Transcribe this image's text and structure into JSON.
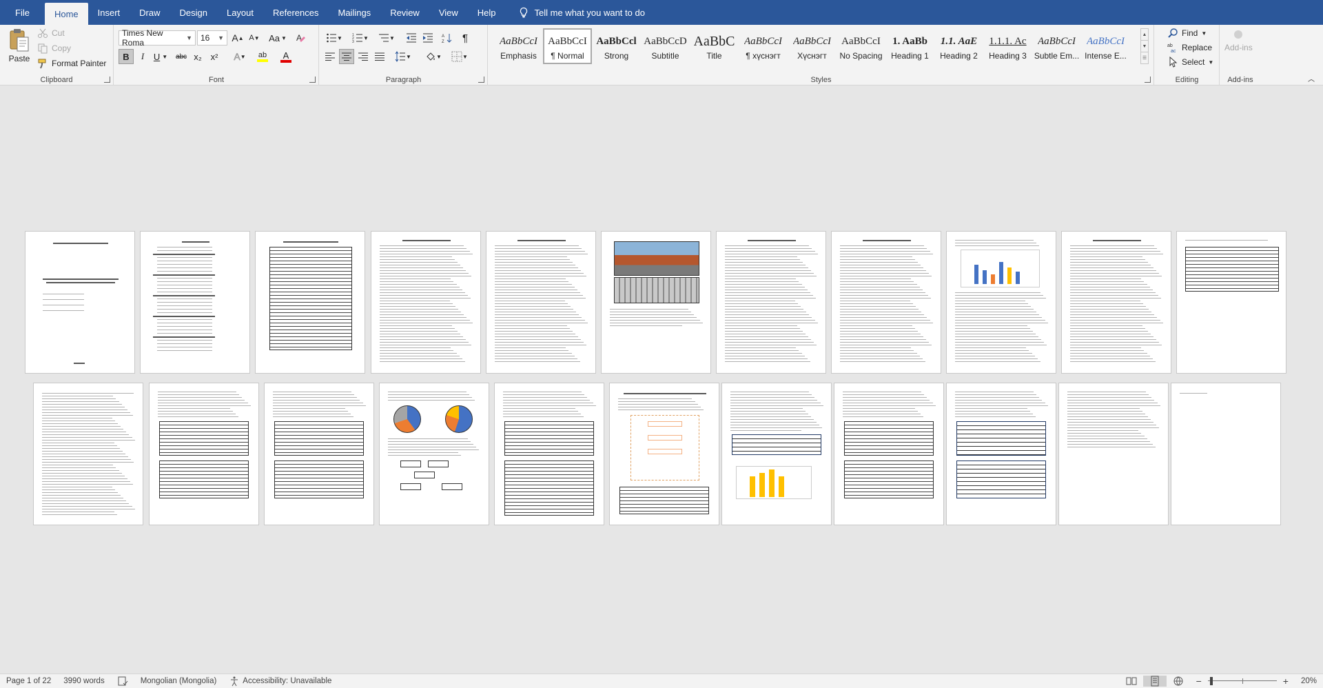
{
  "menu": {
    "tabs": [
      "File",
      "Home",
      "Insert",
      "Draw",
      "Design",
      "Layout",
      "References",
      "Mailings",
      "Review",
      "View",
      "Help"
    ],
    "active": "Home",
    "tell_me": "Tell me what you want to do"
  },
  "clipboard": {
    "paste": "Paste",
    "cut": "Cut",
    "copy": "Copy",
    "format_painter": "Format Painter",
    "label": "Clipboard"
  },
  "font": {
    "name": "Times New Roma",
    "size": "16",
    "label": "Font",
    "bold": "B",
    "italic": "I",
    "underline": "U",
    "strike": "abc",
    "subscript": "x₂",
    "superscript": "x²",
    "grow": "A",
    "shrink": "A",
    "case": "Aa",
    "text_effects": "A",
    "highlight": "ab",
    "font_color": "A",
    "font_color_hex": "#e00000",
    "highlight_hex": "#ffff00"
  },
  "paragraph": {
    "label": "Paragraph",
    "pilcrow": "¶"
  },
  "styles": {
    "label": "Styles",
    "items": [
      {
        "preview": "AaBbCcI",
        "name": "Emphasis",
        "italic": true
      },
      {
        "preview": "AaBbCcI",
        "name": "¶ Normal",
        "selected": true
      },
      {
        "preview": "AaBbCcl",
        "name": "Strong",
        "bold": true
      },
      {
        "preview": "AaBbCcD",
        "name": "Subtitle"
      },
      {
        "preview": "AaBbC",
        "name": "Title",
        "big": true
      },
      {
        "preview": "AaBbCcI",
        "name": "¶ хүснэгт",
        "italic": true
      },
      {
        "preview": "AaBbCcI",
        "name": "Хүснэгт",
        "italic": true
      },
      {
        "preview": "AaBbCcI",
        "name": "No Spacing"
      },
      {
        "preview": "1. AaBb",
        "name": "Heading 1",
        "bold": true
      },
      {
        "preview": "1.1. AaE",
        "name": "Heading 2",
        "bold": true,
        "italic": true
      },
      {
        "preview": "1.1.1. Ac",
        "name": "Heading 3",
        "underline": true
      },
      {
        "preview": "AaBbCcI",
        "name": "Subtle Em...",
        "italic": true
      },
      {
        "preview": "AaBbCcI",
        "name": "Intense E...",
        "italic": true,
        "blue": true
      }
    ]
  },
  "editing": {
    "label": "Editing",
    "find": "Find",
    "replace": "Replace",
    "select": "Select"
  },
  "addins": {
    "label": "Add-ins",
    "button": "Add-ins"
  },
  "status": {
    "page": "Page 1 of 22",
    "words": "3990 words",
    "language": "Mongolian (Mongolia)",
    "accessibility": "Accessibility: Unavailable",
    "zoom": "20%",
    "zoom_level": 0.2
  }
}
